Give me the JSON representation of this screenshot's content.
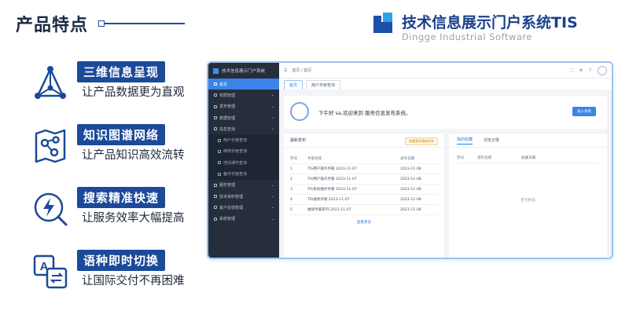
{
  "header": {
    "title": "产品特点",
    "brand_name": "技术信息展示门户系统TIS",
    "brand_sub": "Dingge Industrial Software"
  },
  "features": [
    {
      "icon": "network-pyramid-icon",
      "badge": "三维信息呈现",
      "desc": "让产品数据更为直观"
    },
    {
      "icon": "knowledge-graph-icon",
      "badge": "知识图谱网络",
      "desc": "让产品知识高效流转"
    },
    {
      "icon": "lightning-search-icon",
      "badge": "搜索精准快速",
      "desc": "让服务效率大幅提高"
    },
    {
      "icon": "translate-icon",
      "badge": "语种即时切换",
      "desc": "让国际交付不再困难"
    }
  ],
  "screenshot": {
    "sidebar_title": "技术信息展示门户系统",
    "sidebar_items": [
      {
        "label": "首页",
        "active": true,
        "sub": false,
        "chev": false
      },
      {
        "label": "权限管理",
        "active": false,
        "sub": false,
        "chev": true
      },
      {
        "label": "发布管理",
        "active": false,
        "sub": false,
        "chev": true
      },
      {
        "label": "数据管理",
        "active": false,
        "sub": false,
        "chev": true
      },
      {
        "label": "信息查询",
        "active": false,
        "sub": false,
        "chev": true
      },
      {
        "label": "用户手册查询",
        "active": false,
        "sub": true,
        "chev": false
      },
      {
        "label": "维修手册查询",
        "active": false,
        "sub": true,
        "chev": false
      },
      {
        "label": "培训课件查询",
        "active": false,
        "sub": true,
        "chev": false
      },
      {
        "label": "备件手册查询",
        "active": false,
        "sub": true,
        "chev": false
      },
      {
        "label": "服务管理",
        "active": false,
        "sub": false,
        "chev": true
      },
      {
        "label": "技术资料管理",
        "active": false,
        "sub": false,
        "chev": true
      },
      {
        "label": "客户反馈管理",
        "active": false,
        "sub": false,
        "chev": true
      },
      {
        "label": "系统管理",
        "active": false,
        "sub": false,
        "chev": true
      }
    ],
    "breadcrumb": "首页 / 首页",
    "tabs": [
      "首页",
      "用户手册查询"
    ],
    "welcome_text": "下午好 sa,欢迎来到 服务信息发布系统。",
    "welcome_button": "进入系统",
    "left_panel": {
      "title": "最新发布",
      "tag": "查看更多最新发布",
      "headers": [
        "序号",
        "手册名称",
        "发布日期"
      ],
      "rows": [
        [
          "1",
          "TIS用户操作手册 2023-11-07",
          "2023-11-08"
        ],
        [
          "2",
          "TIS用户操作手册 2023-11-07",
          "2023-11-08"
        ],
        [
          "3",
          "TIS系统维护手册 2023-11-07",
          "2023-11-08"
        ],
        [
          "4",
          "TIS维修手册 2023-11-07",
          "2023-11-08"
        ],
        [
          "5",
          "维修手册系列 2023-11-07",
          "2023-11-08"
        ]
      ],
      "more": "查看更多"
    },
    "right_panel": {
      "tabs": [
        "我的收藏",
        "浏览记录"
      ],
      "headers": [
        "序号",
        "资料名称",
        "收藏日期"
      ],
      "empty": "暂无数据"
    }
  }
}
